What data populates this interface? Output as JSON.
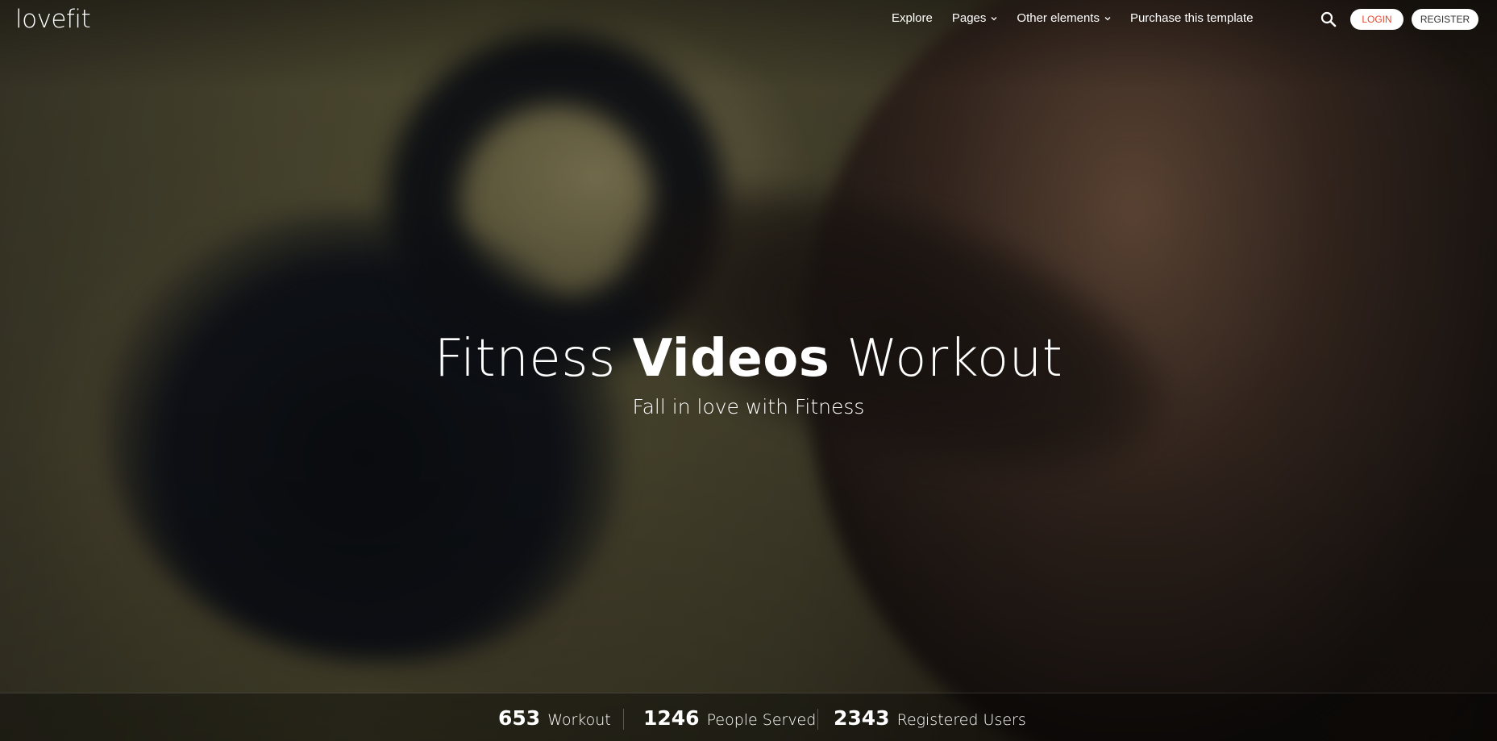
{
  "brand": {
    "logo": "lovefit"
  },
  "nav": {
    "items": [
      {
        "label": "Explore",
        "dropdown": false
      },
      {
        "label": "Pages",
        "dropdown": true
      },
      {
        "label": "Other elements",
        "dropdown": true
      },
      {
        "label": "Purchase this template",
        "dropdown": false
      }
    ]
  },
  "header_actions": {
    "search_icon": "search-icon",
    "login_label": "LOGIN",
    "register_label": "REGISTER"
  },
  "hero": {
    "title_part1": "Fitness",
    "title_bold": "Videos",
    "title_part2": "Workout",
    "subtitle": "Fall in love with Fitness"
  },
  "stats": [
    {
      "value": "653",
      "label": "Workout"
    },
    {
      "value": "1246",
      "label": "People Served"
    },
    {
      "value": "2343",
      "label": "Registered Users"
    }
  ],
  "colors": {
    "login_text": "#e5492f",
    "register_text": "#333333",
    "text": "#ffffff"
  }
}
